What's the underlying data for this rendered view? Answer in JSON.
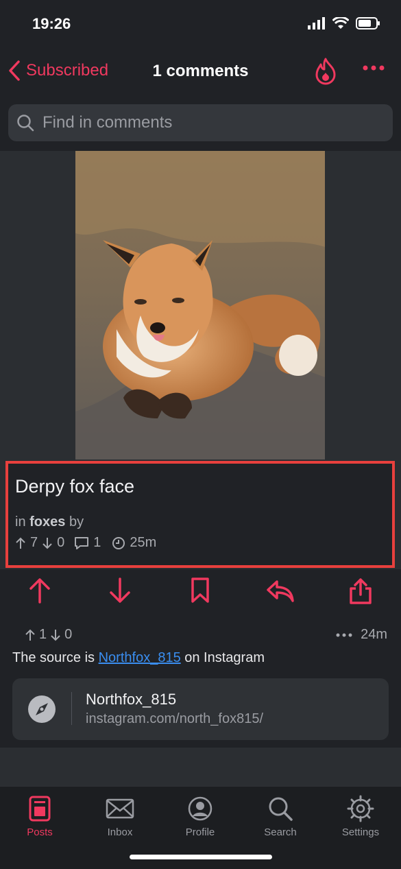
{
  "status": {
    "time": "19:26"
  },
  "nav": {
    "back_label": "Subscribed",
    "title": "1 comments"
  },
  "search": {
    "placeholder": "Find in comments"
  },
  "post": {
    "title": "Derpy fox face",
    "in_label": "in",
    "community": "foxes",
    "by_label": "by",
    "upvotes": "7",
    "downvotes": "0",
    "comments": "1",
    "age": "25m"
  },
  "comment": {
    "upvotes": "1",
    "downvotes": "0",
    "age": "24m",
    "text_before": "The source is ",
    "link_text": "Northfox_815",
    "text_after": " on Instagram",
    "card_title": "Northfox_815",
    "card_url": "instagram.com/north_fox815/"
  },
  "tabs": [
    {
      "label": "Posts"
    },
    {
      "label": "Inbox"
    },
    {
      "label": "Profile"
    },
    {
      "label": "Search"
    },
    {
      "label": "Settings"
    }
  ],
  "colors": {
    "accent": "#f0395f",
    "highlight": "#e8403d",
    "link": "#3a8ef0"
  }
}
